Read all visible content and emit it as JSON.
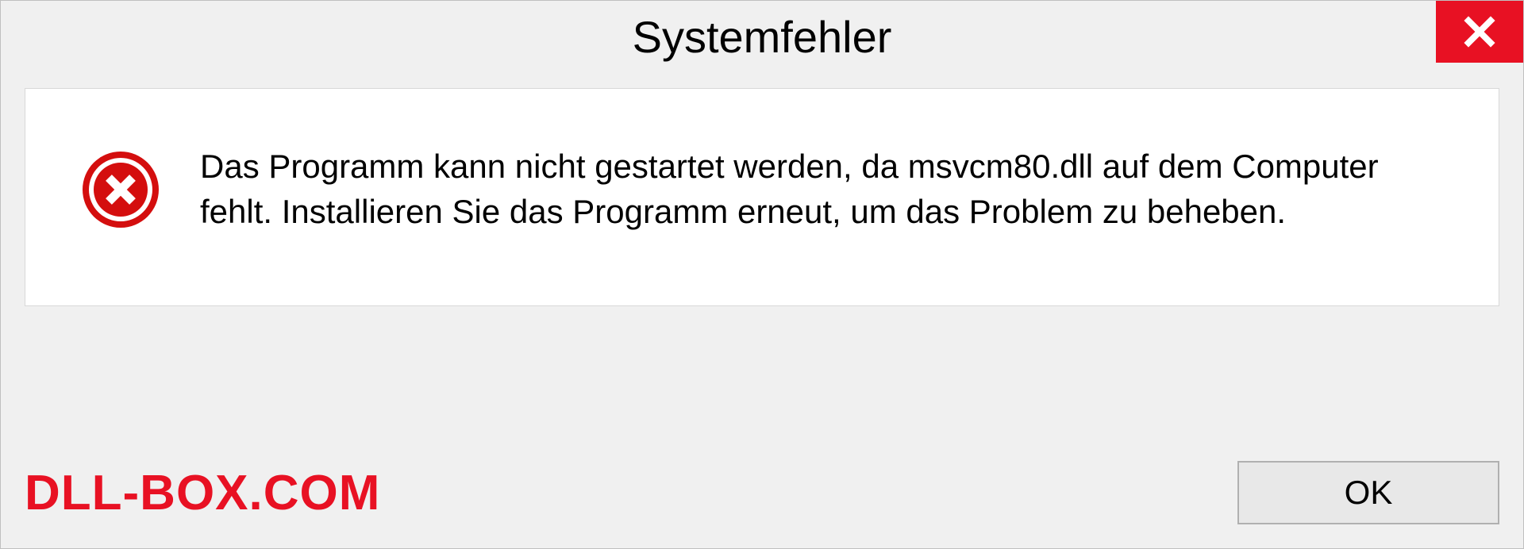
{
  "dialog": {
    "title": "Systemfehler",
    "message": "Das Programm kann nicht gestartet werden, da msvcm80.dll auf dem Computer fehlt. Installieren Sie das Programm erneut, um das Problem zu beheben.",
    "ok_label": "OK"
  },
  "watermark": "DLL-BOX.COM"
}
